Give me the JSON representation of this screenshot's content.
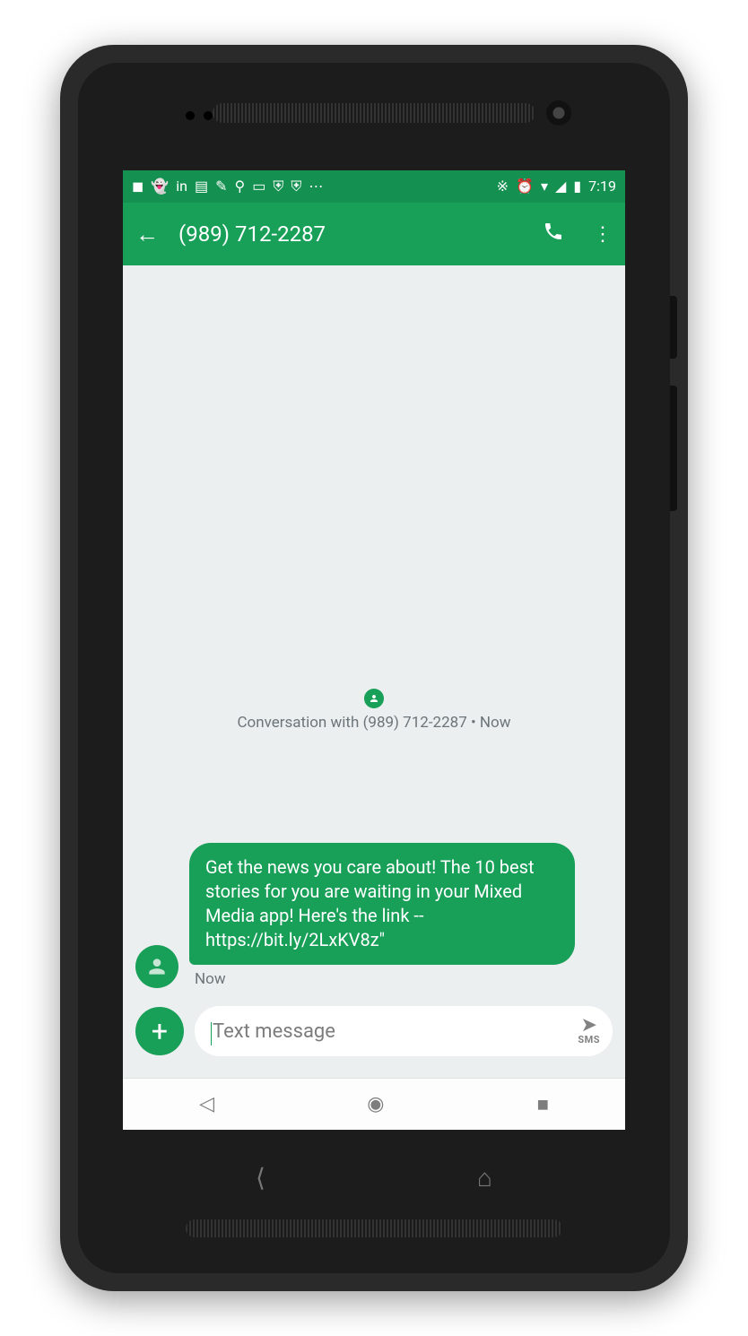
{
  "status": {
    "time": "7:19"
  },
  "header": {
    "title": "(989) 712-2287"
  },
  "conversation": {
    "label": "Conversation with (989) 712-2287 • Now"
  },
  "message": {
    "text": "Get the news you care about! The 10 best stories for you are waiting in your Mixed Media app!  Here's the link -- https://bit.ly/2LxKV8z\"",
    "time": "Now"
  },
  "composer": {
    "placeholder": "Text message",
    "send_label": "SMS"
  }
}
